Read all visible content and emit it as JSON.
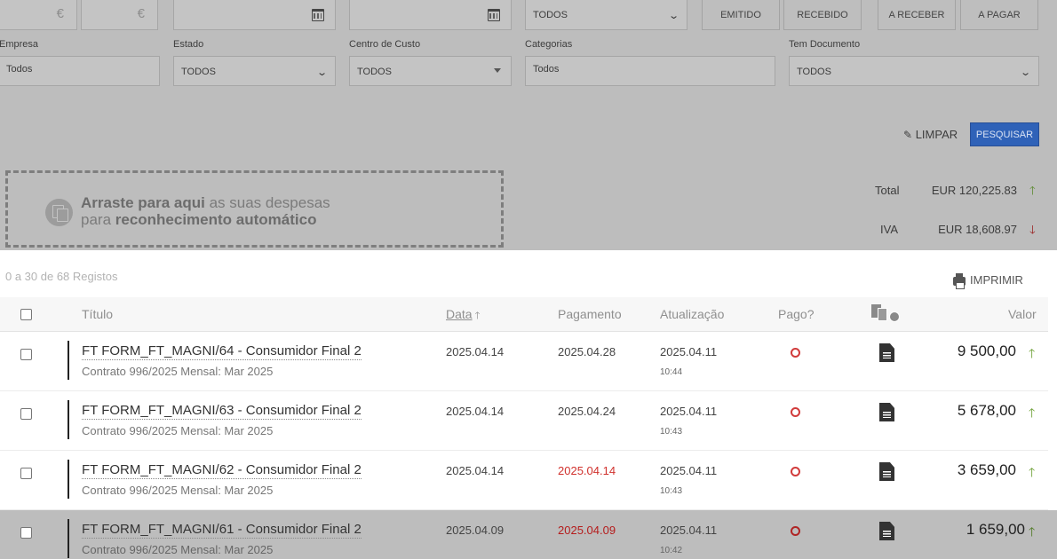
{
  "filters": {
    "value_min": {
      "currency_symbol": "€"
    },
    "value_max": {
      "currency_symbol": "€"
    },
    "type_select": {
      "value": "TODOS"
    },
    "emission_buttons": [
      {
        "label": "EMITIDO"
      },
      {
        "label": "RECEBIDO"
      }
    ],
    "payment_buttons": [
      {
        "label": "A RECEBER"
      },
      {
        "label": "A PAGAR"
      }
    ],
    "empresa": {
      "label": "Empresa",
      "value": "Todos"
    },
    "estado": {
      "label": "Estado",
      "value": "TODOS"
    },
    "centro_custo": {
      "label": "Centro de Custo",
      "value": "TODOS"
    },
    "categorias": {
      "label": "Categorias",
      "value": "Todos"
    },
    "tem_documento": {
      "label": "Tem Documento",
      "value": "TODOS"
    },
    "clear_label": "LIMPAR",
    "search_label": "PESQUISAR"
  },
  "dropzone": {
    "bold1": "Arraste para aqui",
    "normal1": " as suas despesas",
    "normal2": "para ",
    "bold2": "reconhecimento automático"
  },
  "totals": {
    "total_label": "Total",
    "total_value": "EUR 120,225.83",
    "vat_label": "IVA",
    "vat_value": "EUR 18,608.97"
  },
  "list": {
    "record_count": "0 a 30 de 68 Registos",
    "print_label": "IMPRIMIR",
    "columns": {
      "title": "Título",
      "date": "Data",
      "payment": "Pagamento",
      "update": "Atualização",
      "paid": "Pago?",
      "value": "Valor"
    },
    "rows": [
      {
        "title": "FT FORM_FT_MAGNI/64 - Consumidor Final 2",
        "subtitle": "Contrato 996/2025 Mensal: Mar 2025",
        "date": "2025.04.14",
        "payment": "2025.04.28",
        "payment_overdue": false,
        "update_date": "2025.04.11",
        "update_time": "10:44",
        "value": "9 500,00"
      },
      {
        "title": "FT FORM_FT_MAGNI/63 - Consumidor Final 2",
        "subtitle": "Contrato 996/2025 Mensal: Mar 2025",
        "date": "2025.04.14",
        "payment": "2025.04.24",
        "payment_overdue": false,
        "update_date": "2025.04.11",
        "update_time": "10:43",
        "value": "5 678,00"
      },
      {
        "title": "FT FORM_FT_MAGNI/62 - Consumidor Final 2",
        "subtitle": "Contrato 996/2025 Mensal: Mar 2025",
        "date": "2025.04.14",
        "payment": "2025.04.14",
        "payment_overdue": true,
        "update_date": "2025.04.11",
        "update_time": "10:43",
        "value": "3 659,00"
      },
      {
        "title": "FT FORM_FT_MAGNI/61 - Consumidor Final 2",
        "subtitle": "Contrato 996/2025 Mensal: Mar 2025",
        "date": "2025.04.09",
        "payment": "2025.04.09",
        "payment_overdue": true,
        "update_date": "2025.04.11",
        "update_time": "10:42",
        "value": "1 659,00"
      }
    ]
  },
  "colors": {
    "primary_button": "#2f62b8",
    "overdue_red": "#d0312d",
    "up_arrow_green": "#6b9e33",
    "down_arrow_red": "#9a1f1f"
  }
}
